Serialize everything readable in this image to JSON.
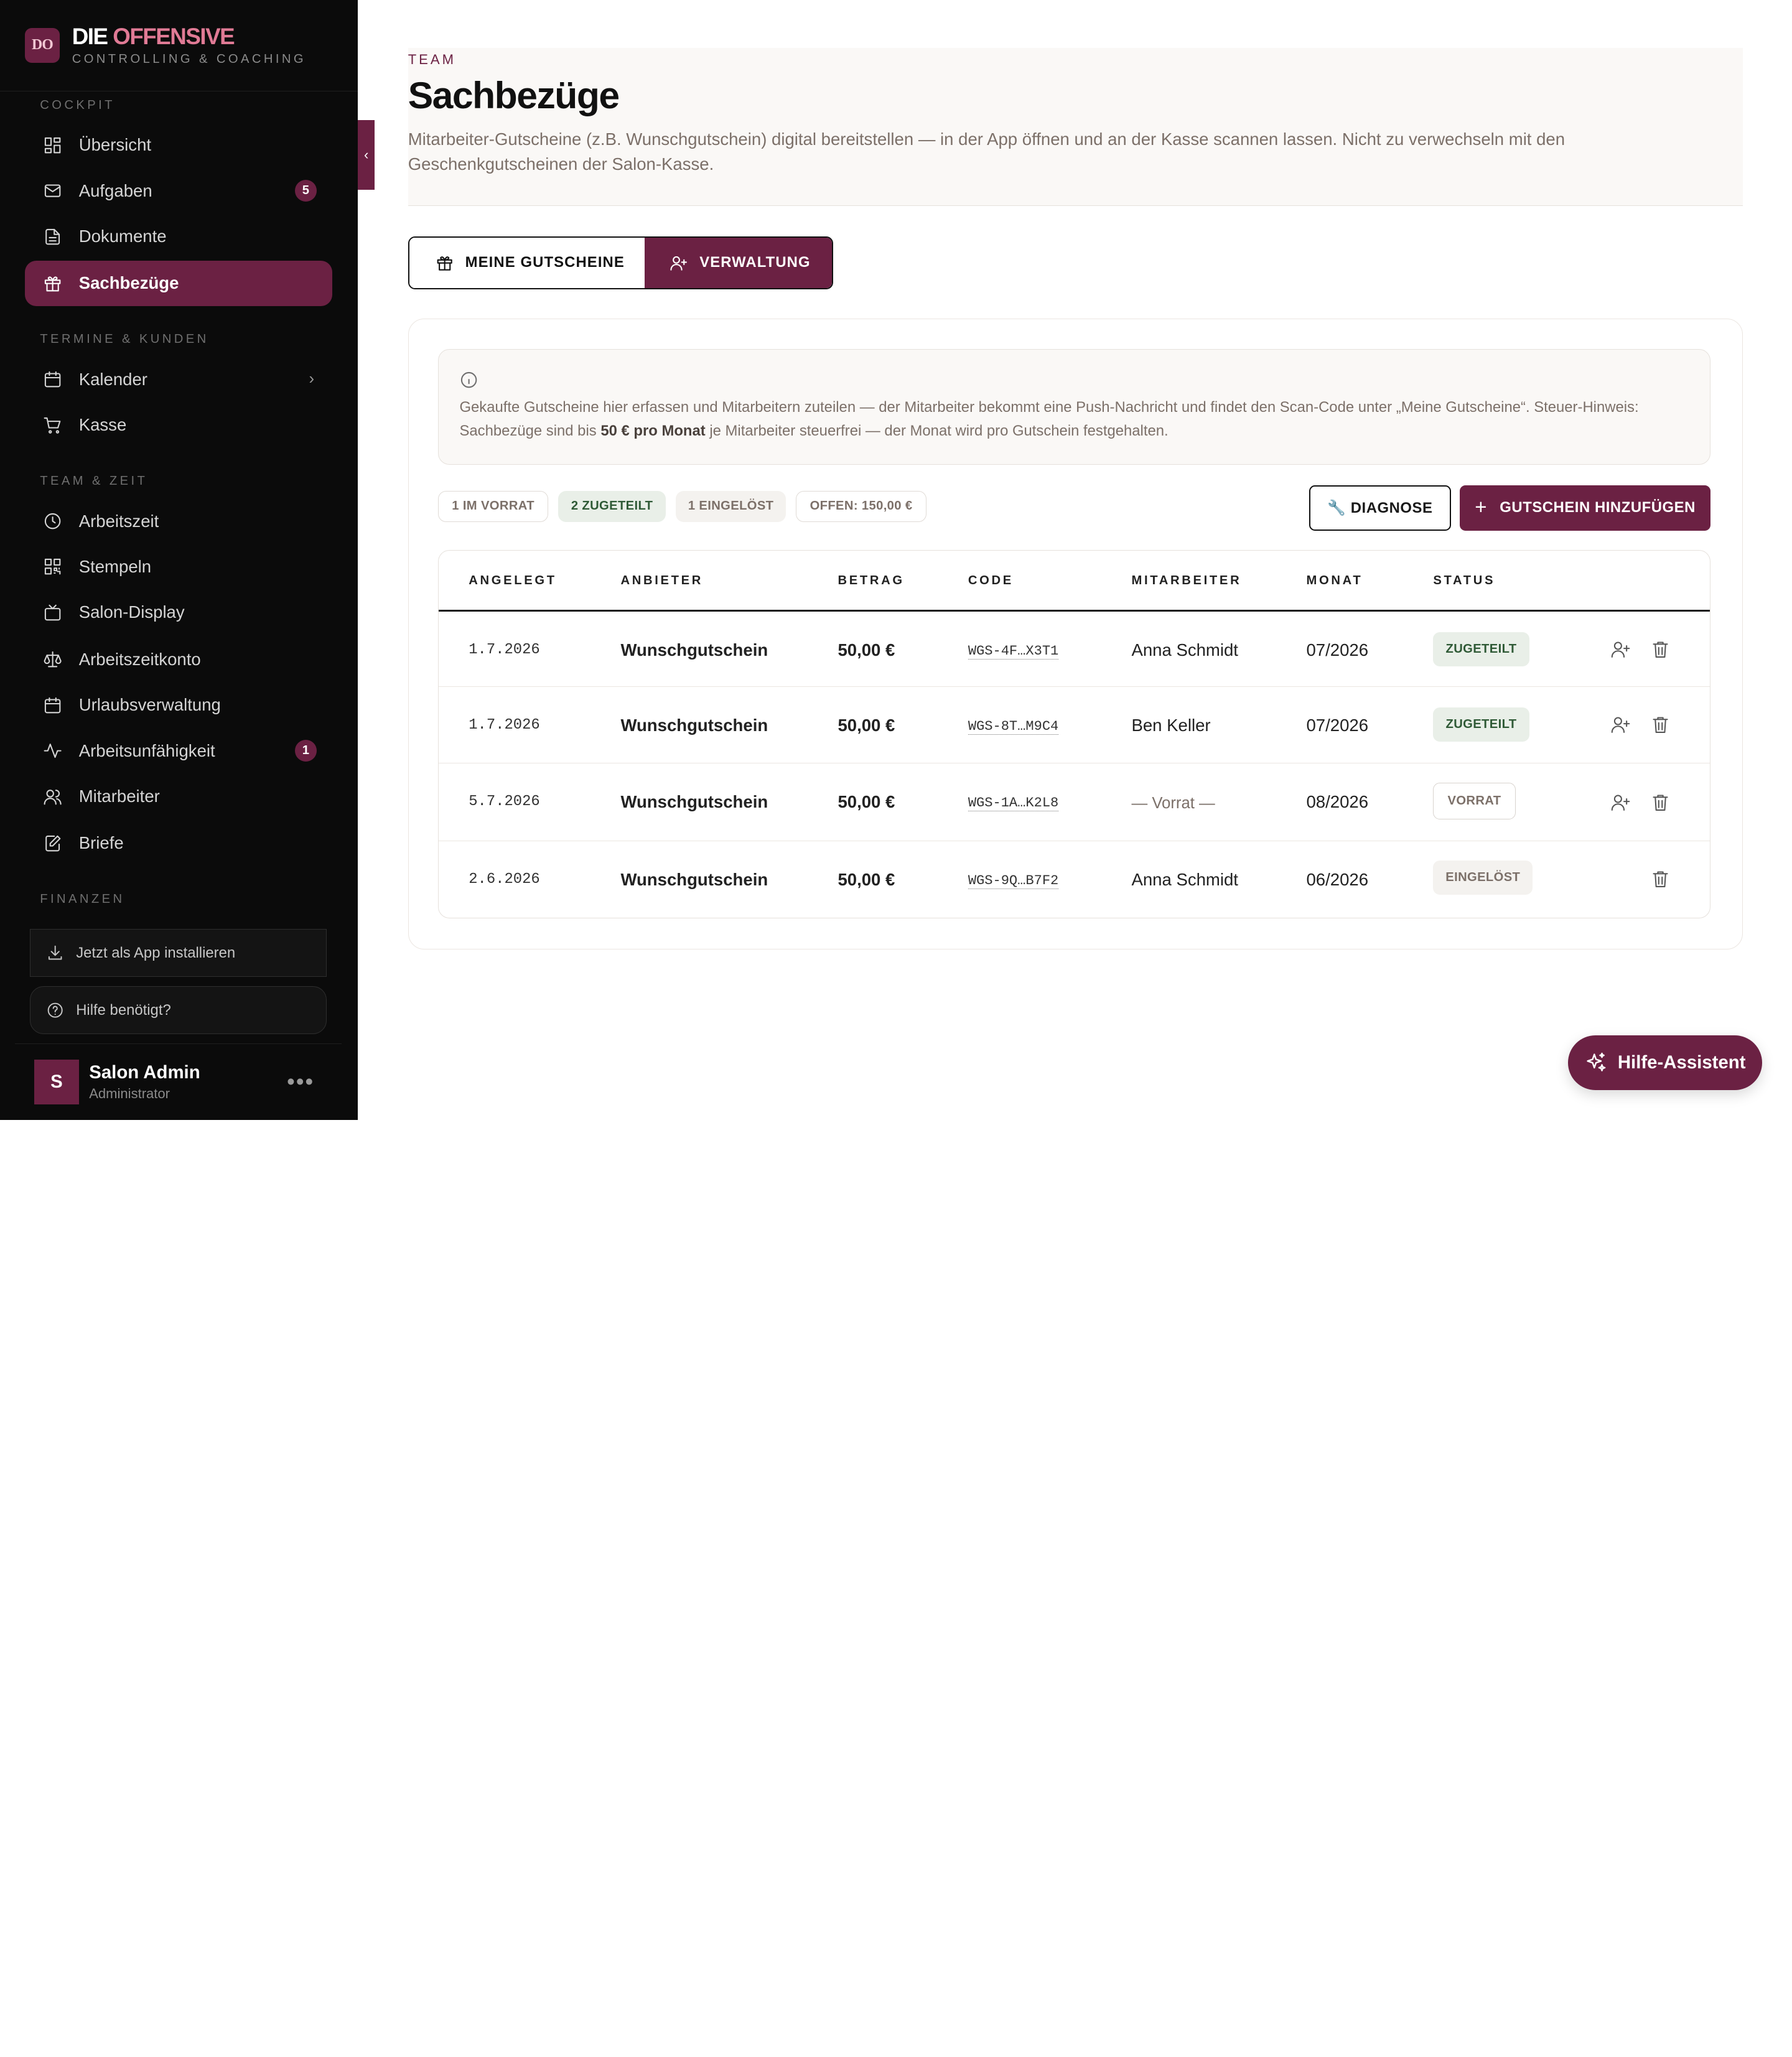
{
  "brand": {
    "logo": "DO",
    "name_main": "DIE",
    "name_accent": "OFFENSIVE",
    "subtitle": "CONTROLLING & COACHING",
    "accent_color": "#6b2143"
  },
  "sidebar": {
    "sections": [
      {
        "label": "COCKPIT"
      },
      {
        "label": "TERMINE & KUNDEN"
      },
      {
        "label": "TEAM & ZEIT"
      },
      {
        "label": "FINANZEN"
      }
    ],
    "items": [
      {
        "label": "Übersicht",
        "icon": "dashboard-icon"
      },
      {
        "label": "Aufgaben",
        "icon": "mail-icon",
        "badge": "5"
      },
      {
        "label": "Dokumente",
        "icon": "document-icon"
      },
      {
        "label": "Sachbezüge",
        "icon": "gift-icon",
        "active": true
      },
      {
        "label": "Kalender",
        "icon": "calendar-icon",
        "chevron": true
      },
      {
        "label": "Kasse",
        "icon": "cart-icon"
      },
      {
        "label": "Arbeitszeit",
        "icon": "clock-icon"
      },
      {
        "label": "Stempeln",
        "icon": "qr-code-icon"
      },
      {
        "label": "Salon-Display",
        "icon": "tv-icon"
      },
      {
        "label": "Arbeitszeitkonto",
        "icon": "scale-icon"
      },
      {
        "label": "Urlaubsverwaltung",
        "icon": "calendar-icon"
      },
      {
        "label": "Arbeitsunfähigkeit",
        "icon": "activity-icon",
        "badge": "1"
      },
      {
        "label": "Mitarbeiter",
        "icon": "users-icon"
      },
      {
        "label": "Briefe",
        "icon": "edit-icon"
      }
    ],
    "install_label": "Jetzt als App installieren",
    "help_label": "Hilfe benötigt?",
    "user": {
      "initial": "S",
      "name": "Salon Admin",
      "role": "Administrator"
    }
  },
  "header": {
    "eyebrow": "TEAM",
    "title": "Sachbezüge",
    "description": "Mitarbeiter-Gutscheine (z.B. Wunschgutschein) digital bereitstellen — in der App öffnen und an der Kasse scannen lassen. Nicht zu verwechseln mit den Geschenkgutscheinen der Salon-Kasse."
  },
  "tabs": [
    {
      "label": "MEINE GUTSCHEINE",
      "icon": "gift-icon"
    },
    {
      "label": "VERWALTUNG",
      "icon": "user-plus-icon",
      "active": true
    }
  ],
  "info": {
    "text_before": "Gekaufte Gutscheine hier erfassen und Mitarbeitern zuteilen — der Mitarbeiter bekommt eine Push-Nachricht und findet den Scan-Code unter „Meine Gutscheine“. Steuer-Hinweis: Sachbezüge sind bis ",
    "text_bold": "50 € pro Monat",
    "text_after": " je Mitarbeiter steuerfrei — der Monat wird pro Gutschein festgehalten."
  },
  "chips": [
    {
      "label": "1 IM VORRAT"
    },
    {
      "label": "2 ZUGETEILT"
    },
    {
      "label": "1 EINGELÖST"
    },
    {
      "label": "OFFEN: 150,00 €"
    }
  ],
  "actions": {
    "diagnose_label": "🔧 DIAGNOSE",
    "add_label": "GUTSCHEIN HINZUFÜGEN",
    "add_plus": "+"
  },
  "table": {
    "columns": [
      "ANGELEGT",
      "ANBIETER",
      "BETRAG",
      "CODE",
      "MITARBEITER",
      "MONAT",
      "STATUS"
    ],
    "rows": [
      {
        "angelegt": "1.7.2026",
        "anbieter": "Wunschgutschein",
        "betrag": "50,00 €",
        "code": "WGS-4F…X3T1",
        "mitarbeiter": "Anna Schmidt",
        "monat": "07/2026",
        "status": "ZUGETEILT"
      },
      {
        "angelegt": "1.7.2026",
        "anbieter": "Wunschgutschein",
        "betrag": "50,00 €",
        "code": "WGS-8T…M9C4",
        "mitarbeiter": "Ben Keller",
        "monat": "07/2026",
        "status": "ZUGETEILT"
      },
      {
        "angelegt": "5.7.2026",
        "anbieter": "Wunschgutschein",
        "betrag": "50,00 €",
        "code": "WGS-1A…K2L8",
        "mitarbeiter": "— Vorrat —",
        "monat": "08/2026",
        "status": "VORRAT"
      },
      {
        "angelegt": "2.6.2026",
        "anbieter": "Wunschgutschein",
        "betrag": "50,00 €",
        "code": "WGS-9Q…B7F2",
        "mitarbeiter": "Anna Schmidt",
        "monat": "06/2026",
        "status": "EINGELÖST"
      }
    ]
  },
  "assistant": {
    "label": "Hilfe-Assistent",
    "icon": "sparkles-icon"
  }
}
